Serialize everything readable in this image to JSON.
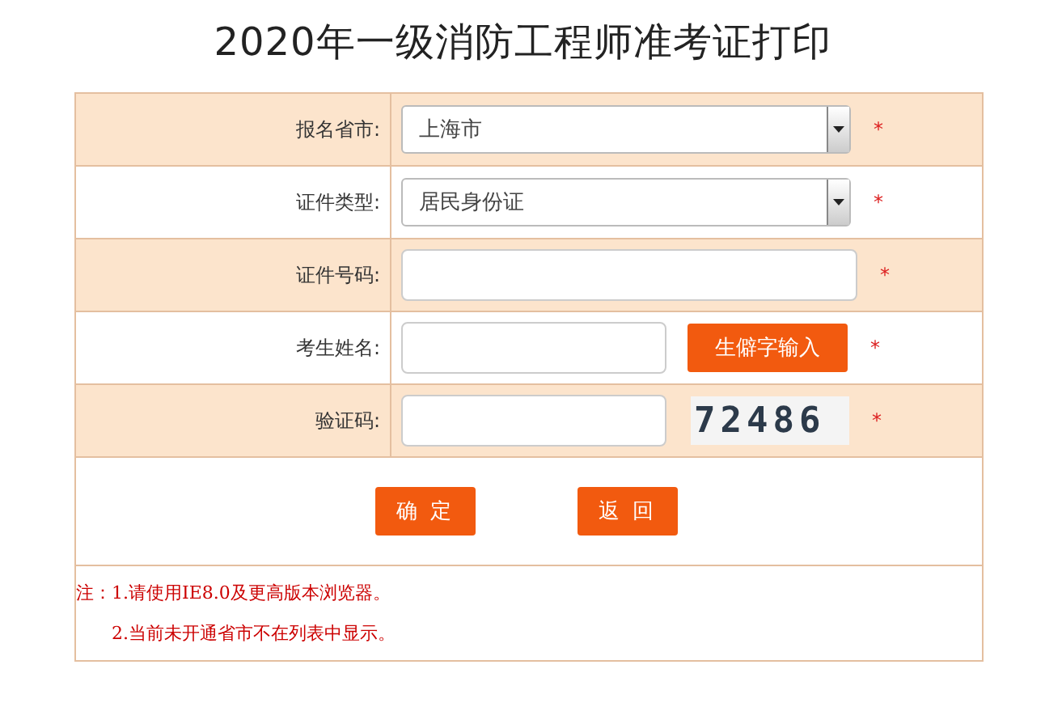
{
  "title": "2020年一级消防工程师准考证打印",
  "rows": [
    {
      "label": "报名省市:",
      "kind": "select",
      "value": "上海市",
      "mark": "*"
    },
    {
      "label": "证件类型:",
      "kind": "select",
      "value": "居民身份证",
      "mark": "*"
    },
    {
      "label": "证件号码:",
      "kind": "text",
      "mark": "*"
    },
    {
      "label": "考生姓名:",
      "kind": "text_button",
      "button": "生僻字输入",
      "mark": "*"
    },
    {
      "label": "验证码:",
      "kind": "captcha",
      "captcha": "72486",
      "mark": "*"
    }
  ],
  "buttons": [
    "确 定",
    "返 回"
  ],
  "notes": {
    "prefix": "注：",
    "items": [
      "1.请使用IE8.0及更高版本浏览器。",
      "2.当前未开通省市不在列表中显示。"
    ]
  }
}
